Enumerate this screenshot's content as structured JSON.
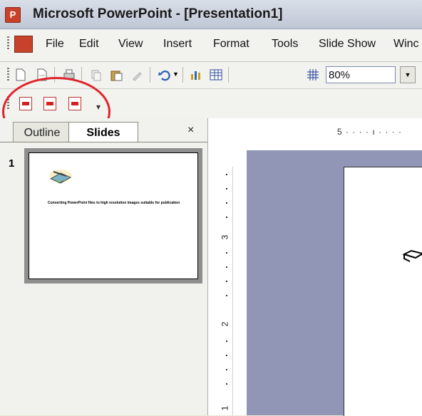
{
  "window": {
    "title": "Microsoft PowerPoint - [Presentation1]"
  },
  "menu": {
    "items": [
      "File",
      "Edit",
      "View",
      "Insert",
      "Format",
      "Tools",
      "Slide Show",
      "Winc"
    ]
  },
  "toolbar": {
    "zoom": "80%"
  },
  "panel": {
    "tabs": {
      "outline": "Outline",
      "slides": "Slides"
    },
    "close": "×",
    "slide_number": "1",
    "thumb_caption": "Converting PowerPoint files to high resolution images suitable for publication"
  },
  "ruler": {
    "horizontal": "5 · · · · ı · · · ·",
    "v_label_3": "3",
    "v_label_2": "2",
    "v_label_1": "1"
  }
}
